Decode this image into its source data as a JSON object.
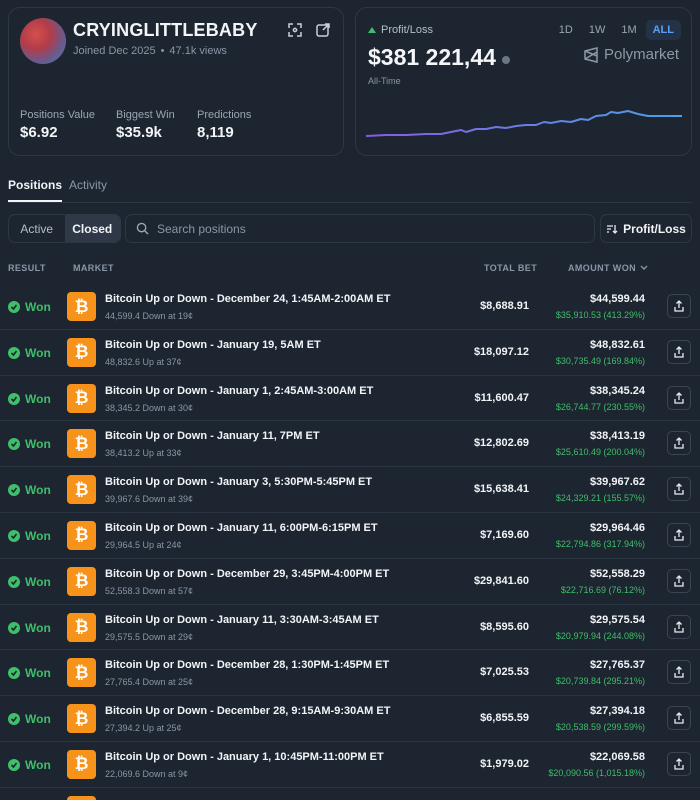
{
  "profile": {
    "username": "CRYINGLITTLEBABY",
    "joined": "Joined Dec 2025",
    "views": "47.1k views",
    "stats": [
      {
        "label": "Positions Value",
        "value": "$6.92"
      },
      {
        "label": "Biggest Win",
        "value": "$35.9k"
      },
      {
        "label": "Predictions",
        "value": "8,119"
      }
    ]
  },
  "pnl": {
    "title": "Profit/Loss",
    "value": "$381 221,44",
    "period": "All-Time",
    "ranges": [
      "1D",
      "1W",
      "1M",
      "ALL"
    ],
    "active_range": "ALL",
    "brand": "Polymarket"
  },
  "tabs": {
    "positions": "Positions",
    "activity": "Activity"
  },
  "filters": {
    "active": "Active",
    "closed": "Closed",
    "search_placeholder": "Search positions",
    "sort_label": "Profit/Loss"
  },
  "table_headers": {
    "result": "RESULT",
    "market": "MARKET",
    "total_bet": "TOTAL BET",
    "amount_won": "AMOUNT WON"
  },
  "positions": [
    {
      "result": "Won",
      "title": "Bitcoin Up or Down - December 24, 1:45AM-2:00AM ET",
      "sub": "44,599.4 Down at 19¢",
      "bet": "$8,688.91",
      "won": "$44,599.44",
      "gain": "$35,910.53 (413.29%)"
    },
    {
      "result": "Won",
      "title": "Bitcoin Up or Down - January 19, 5AM ET",
      "sub": "48,832.6 Up at 37¢",
      "bet": "$18,097.12",
      "won": "$48,832.61",
      "gain": "$30,735.49 (169.84%)"
    },
    {
      "result": "Won",
      "title": "Bitcoin Up or Down - January 1, 2:45AM-3:00AM ET",
      "sub": "38,345.2 Down at 30¢",
      "bet": "$11,600.47",
      "won": "$38,345.24",
      "gain": "$26,744.77 (230.55%)"
    },
    {
      "result": "Won",
      "title": "Bitcoin Up or Down - January 11, 7PM ET",
      "sub": "38,413.2 Up at 33¢",
      "bet": "$12,802.69",
      "won": "$38,413.19",
      "gain": "$25,610.49 (200.04%)"
    },
    {
      "result": "Won",
      "title": "Bitcoin Up or Down - January 3, 5:30PM-5:45PM ET",
      "sub": "39,967.6 Down at 39¢",
      "bet": "$15,638.41",
      "won": "$39,967.62",
      "gain": "$24,329.21 (155.57%)"
    },
    {
      "result": "Won",
      "title": "Bitcoin Up or Down - January 11, 6:00PM-6:15PM ET",
      "sub": "29,964.5 Up at 24¢",
      "bet": "$7,169.60",
      "won": "$29,964.46",
      "gain": "$22,794.86 (317.94%)"
    },
    {
      "result": "Won",
      "title": "Bitcoin Up or Down - December 29, 3:45PM-4:00PM ET",
      "sub": "52,558.3 Down at 57¢",
      "bet": "$29,841.60",
      "won": "$52,558.29",
      "gain": "$22,716.69 (76.12%)"
    },
    {
      "result": "Won",
      "title": "Bitcoin Up or Down - January 11, 3:30AM-3:45AM ET",
      "sub": "29,575.5 Down at 29¢",
      "bet": "$8,595.60",
      "won": "$29,575.54",
      "gain": "$20,979.94 (244.08%)"
    },
    {
      "result": "Won",
      "title": "Bitcoin Up or Down - December 28, 1:30PM-1:45PM ET",
      "sub": "27,765.4 Down at 25¢",
      "bet": "$7,025.53",
      "won": "$27,765.37",
      "gain": "$20,739.84 (295.21%)"
    },
    {
      "result": "Won",
      "title": "Bitcoin Up or Down - December 28, 9:15AM-9:30AM ET",
      "sub": "27,394.2 Up at 25¢",
      "bet": "$6,855.59",
      "won": "$27,394.18",
      "gain": "$20,538.59 (299.59%)"
    },
    {
      "result": "Won",
      "title": "Bitcoin Up or Down - January 1, 10:45PM-11:00PM ET",
      "sub": "22,069.6 Down at 9¢",
      "bet": "$1,979.02",
      "won": "$22,069.58",
      "gain": "$20,090.56 (1,015.18%)"
    }
  ],
  "colors": {
    "background": "#1d2530",
    "accent": "#5aa0f2",
    "win": "#3fbf6a",
    "bitcoin": "#f7931a"
  },
  "icons": [
    "expand-icon",
    "external-link-icon",
    "info-icon",
    "polymarket-logo",
    "search-icon",
    "sort-icon",
    "chevron-down-icon",
    "check-icon",
    "bitcoin-icon",
    "share-icon"
  ]
}
